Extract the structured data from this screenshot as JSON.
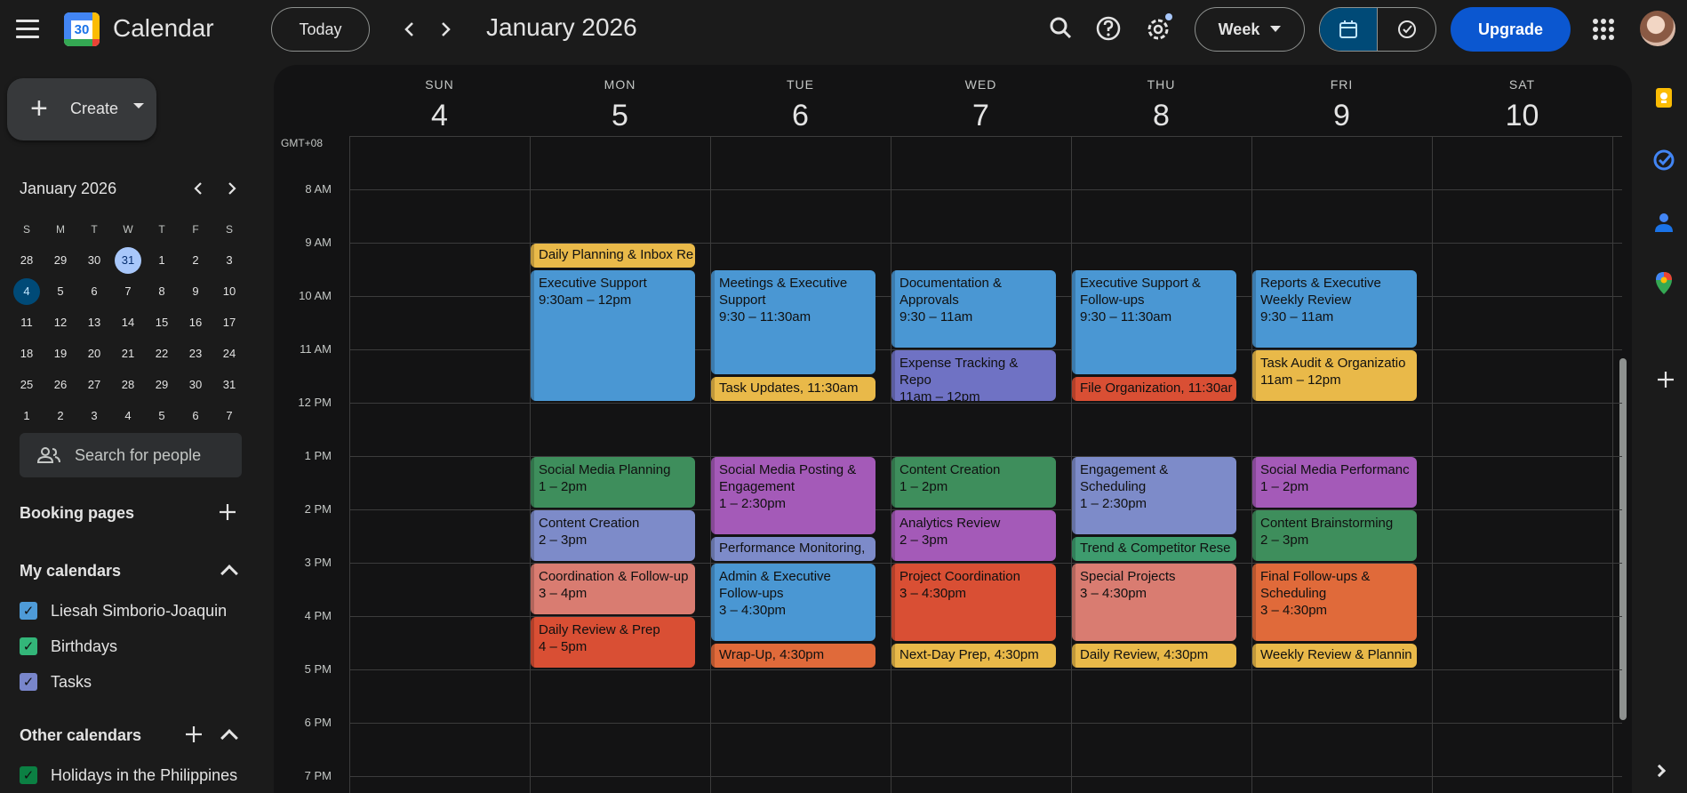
{
  "app": {
    "name": "Calendar",
    "logo_day": "30"
  },
  "header": {
    "today_label": "Today",
    "period_title": "January 2026",
    "view_label": "Week",
    "upgrade_label": "Upgrade"
  },
  "sidebar": {
    "create_label": "Create",
    "mini_calendar": {
      "title": "January 2026",
      "weekday_headers": [
        "S",
        "M",
        "T",
        "W",
        "T",
        "F",
        "S"
      ],
      "weeks": [
        [
          "28",
          "29",
          "30",
          "31",
          "1",
          "2",
          "3"
        ],
        [
          "4",
          "5",
          "6",
          "7",
          "8",
          "9",
          "10"
        ],
        [
          "11",
          "12",
          "13",
          "14",
          "15",
          "16",
          "17"
        ],
        [
          "18",
          "19",
          "20",
          "21",
          "22",
          "23",
          "24"
        ],
        [
          "25",
          "26",
          "27",
          "28",
          "29",
          "30",
          "31"
        ],
        [
          "1",
          "2",
          "3",
          "4",
          "5",
          "6",
          "7"
        ]
      ],
      "today": "31",
      "selected": "4"
    },
    "search_people_placeholder": "Search for people",
    "booking_pages_label": "Booking pages",
    "my_calendars_label": "My calendars",
    "my_calendars": [
      {
        "name": "Liesah Simborio-Joaquin",
        "color": "#4e9bd8"
      },
      {
        "name": "Birthdays",
        "color": "#33b679"
      },
      {
        "name": "Tasks",
        "color": "#7986cb"
      }
    ],
    "other_calendars_label": "Other calendars",
    "other_calendars": [
      {
        "name": "Holidays in the Philippines",
        "color": "#0b8043"
      }
    ]
  },
  "week": {
    "timezone": "GMT+08",
    "days": [
      {
        "name": "SUN",
        "date": "4"
      },
      {
        "name": "MON",
        "date": "5"
      },
      {
        "name": "TUE",
        "date": "6"
      },
      {
        "name": "WED",
        "date": "7"
      },
      {
        "name": "THU",
        "date": "8"
      },
      {
        "name": "FRI",
        "date": "9"
      },
      {
        "name": "SAT",
        "date": "10"
      }
    ],
    "hours": [
      "8 AM",
      "9 AM",
      "10 AM",
      "11 AM",
      "12 PM",
      "1 PM",
      "2 PM",
      "3 PM",
      "4 PM",
      "5 PM",
      "6 PM",
      "7 PM"
    ]
  },
  "events": [
    {
      "day": 1,
      "start": 9.0,
      "end": 9.5,
      "title": "Daily Planning & Inbox Re",
      "time": "",
      "color": "#e9b949",
      "single": true
    },
    {
      "day": 1,
      "start": 9.5,
      "end": 12.0,
      "title": "Executive Support",
      "time": "9:30am – 12pm",
      "color": "#4a97d3"
    },
    {
      "day": 1,
      "start": 13.0,
      "end": 14.0,
      "title": "Social Media Planning",
      "time": "1 – 2pm",
      "color": "#3e8e5c"
    },
    {
      "day": 1,
      "start": 14.0,
      "end": 15.0,
      "title": "Content Creation",
      "time": "2 – 3pm",
      "color": "#7d8bc9"
    },
    {
      "day": 1,
      "start": 15.0,
      "end": 16.0,
      "title": "Coordination & Follow-up",
      "time": "3 – 4pm",
      "color": "#d97c71"
    },
    {
      "day": 1,
      "start": 16.0,
      "end": 17.0,
      "title": "Daily Review & Prep",
      "time": "4 – 5pm",
      "color": "#d94f34"
    },
    {
      "day": 2,
      "start": 9.5,
      "end": 11.5,
      "title": "Meetings & Executive Support",
      "time": "9:30 – 11:30am",
      "color": "#4a97d3"
    },
    {
      "day": 2,
      "start": 11.5,
      "end": 12.0,
      "title": "Task Updates",
      "time": "11:30am",
      "color": "#e9b949",
      "single": true
    },
    {
      "day": 2,
      "start": 13.0,
      "end": 14.5,
      "title": "Social Media Posting & Engagement",
      "time": "1 – 2:30pm",
      "color": "#a45ab8"
    },
    {
      "day": 2,
      "start": 14.5,
      "end": 15.0,
      "title": "Performance Monitoring,",
      "time": "",
      "color": "#7d8bc9",
      "single": true
    },
    {
      "day": 2,
      "start": 15.0,
      "end": 16.5,
      "title": "Admin & Executive Follow-ups",
      "time": "3 – 4:30pm",
      "color": "#4a97d3"
    },
    {
      "day": 2,
      "start": 16.5,
      "end": 17.0,
      "title": "Wrap-Up",
      "time": "4:30pm",
      "color": "#e06a3a",
      "single": true
    },
    {
      "day": 3,
      "start": 9.5,
      "end": 11.0,
      "title": "Documentation & Approvals",
      "time": "9:30 – 11am",
      "color": "#4a97d3"
    },
    {
      "day": 3,
      "start": 11.0,
      "end": 12.0,
      "title": "Expense Tracking & Repo",
      "time": "11am – 12pm",
      "color": "#6f72c4"
    },
    {
      "day": 3,
      "start": 13.0,
      "end": 14.0,
      "title": "Content Creation",
      "time": "1 – 2pm",
      "color": "#3e8e5c"
    },
    {
      "day": 3,
      "start": 14.0,
      "end": 15.0,
      "title": "Analytics Review",
      "time": "2 – 3pm",
      "color": "#a45ab8"
    },
    {
      "day": 3,
      "start": 15.0,
      "end": 16.5,
      "title": "Project Coordination",
      "time": "3 – 4:30pm",
      "color": "#d94f34"
    },
    {
      "day": 3,
      "start": 16.5,
      "end": 17.0,
      "title": "Next-Day Prep",
      "time": "4:30pm",
      "color": "#e9b949",
      "single": true
    },
    {
      "day": 4,
      "start": 9.5,
      "end": 11.5,
      "title": "Executive Support & Follow-ups",
      "time": "9:30 – 11:30am",
      "color": "#4a97d3"
    },
    {
      "day": 4,
      "start": 11.5,
      "end": 12.0,
      "title": "File Organization",
      "time": "11:30ar",
      "color": "#d94f34",
      "single": true
    },
    {
      "day": 4,
      "start": 13.0,
      "end": 14.5,
      "title": "Engagement & Scheduling",
      "time": "1 – 2:30pm",
      "color": "#7d8bc9"
    },
    {
      "day": 4,
      "start": 14.5,
      "end": 15.0,
      "title": "Trend & Competitor Rese",
      "time": "",
      "color": "#3e9c6e",
      "single": true
    },
    {
      "day": 4,
      "start": 15.0,
      "end": 16.5,
      "title": "Special Projects",
      "time": "3 – 4:30pm",
      "color": "#d97c71"
    },
    {
      "day": 4,
      "start": 16.5,
      "end": 17.0,
      "title": "Daily Review",
      "time": "4:30pm",
      "color": "#e9b949",
      "single": true
    },
    {
      "day": 5,
      "start": 9.5,
      "end": 11.0,
      "title": "Reports & Executive Weekly Review",
      "time": "9:30 – 11am",
      "color": "#4a97d3"
    },
    {
      "day": 5,
      "start": 11.0,
      "end": 12.0,
      "title": "Task Audit & Organizatio",
      "time": "11am – 12pm",
      "color": "#e9b949"
    },
    {
      "day": 5,
      "start": 13.0,
      "end": 14.0,
      "title": "Social Media Performanc",
      "time": "1 – 2pm",
      "color": "#a45ab8"
    },
    {
      "day": 5,
      "start": 14.0,
      "end": 15.0,
      "title": "Content Brainstorming",
      "time": "2 – 3pm",
      "color": "#3e8e5c"
    },
    {
      "day": 5,
      "start": 15.0,
      "end": 16.5,
      "title": "Final Follow-ups & Scheduling",
      "time": "3 – 4:30pm",
      "color": "#e06a3a"
    },
    {
      "day": 5,
      "start": 16.5,
      "end": 17.0,
      "title": "Weekly Review & Plannin",
      "time": "",
      "color": "#e9b949",
      "single": true
    }
  ]
}
